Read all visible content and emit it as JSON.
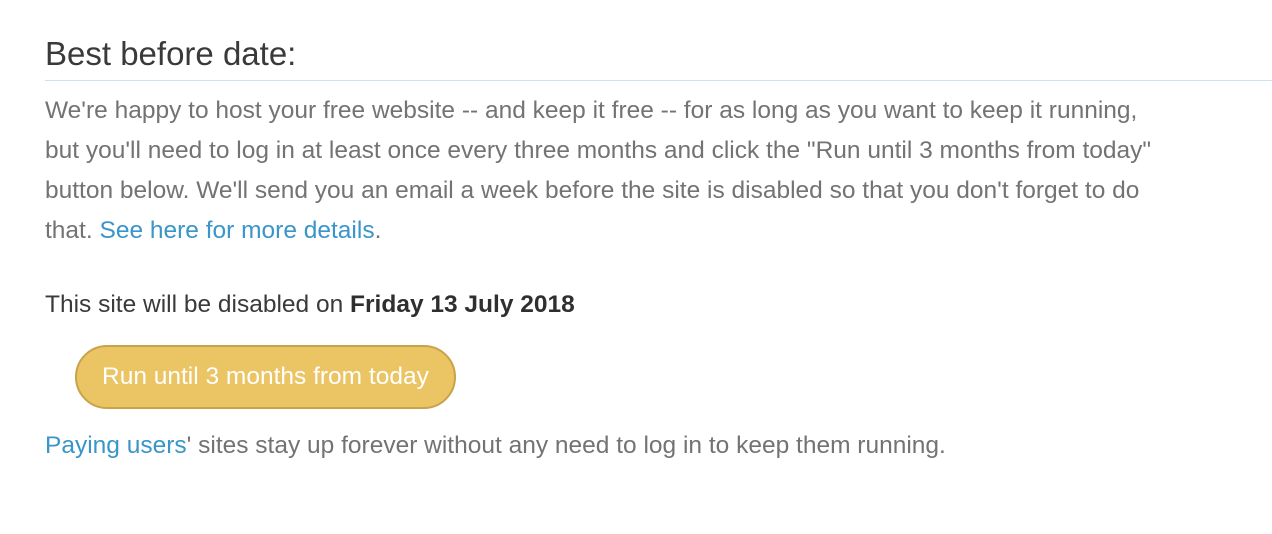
{
  "section": {
    "heading": "Best before date:"
  },
  "intro": {
    "text": "We're happy to host your free website -- and keep it free -- for as long as you want to keep it running, but you'll need to log in at least once every three months and click the \"Run until 3 months from today\" button below. We'll send you an email a week before the site is disabled so that you don't forget to do that. ",
    "link_label": "See here for more details",
    "trailing": "."
  },
  "status": {
    "prefix": "This site will be disabled on ",
    "date": "Friday 13 July 2018"
  },
  "run_button": {
    "label": "Run until 3 months from today"
  },
  "paying": {
    "link_label": "Paying users",
    "text": "' sites stay up forever without any need to log in to keep them running."
  },
  "colors": {
    "link": "#3a95c9",
    "button_fill": "#ebc463",
    "button_border": "#c9a34a",
    "heading_rule": "#c9e3f3"
  }
}
